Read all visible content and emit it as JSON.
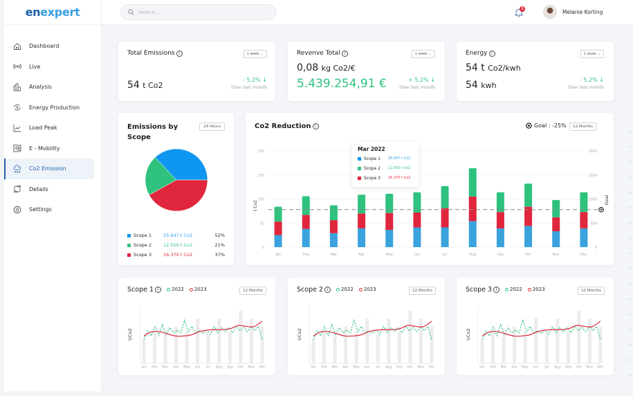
{
  "app": {
    "logo_part1": "en",
    "logo_part2": "expert"
  },
  "topbar": {
    "search_placeholder": "Search...",
    "notification_count": "2",
    "user_name": "Melanie Korting"
  },
  "sidebar": {
    "items": [
      {
        "label": "Dashboard",
        "icon": "home-icon"
      },
      {
        "label": "Live",
        "icon": "live-signal-icon"
      },
      {
        "label": "Analysis",
        "icon": "analysis-bars-icon"
      },
      {
        "label": "Energy Production",
        "icon": "energy-cycle-icon"
      },
      {
        "label": "Load Peak",
        "icon": "line-chart-icon"
      },
      {
        "label": "E - Mobility",
        "icon": "ev-charger-icon"
      },
      {
        "label": "Co2 Emission",
        "icon": "co2-cloud-icon",
        "active": true
      },
      {
        "label": "Details",
        "icon": "details-flow-icon"
      },
      {
        "label": "Settings",
        "icon": "gear-icon"
      }
    ]
  },
  "kpis": {
    "total_emissions": {
      "title": "Total Emissions",
      "period": "1 week",
      "value": "54",
      "unit": "t Co2",
      "delta": "- 5,2% ↓",
      "delta_label": "than last month"
    },
    "revenue_total": {
      "title": "Revenve Total",
      "period": "1 week",
      "value": "0,08",
      "unit": "kg Co2/€",
      "amount": "5.439.254,91 €",
      "delta": "+ 5,2% ↓",
      "delta_label": "than last month"
    },
    "energy": {
      "title": "Energy",
      "period": "1 week",
      "value": "54 t",
      "unit": "Co2/kwh",
      "value2": "54",
      "unit2": "kwh",
      "delta": "- 5,2% ↓",
      "delta_label": "than last month"
    }
  },
  "colors": {
    "scope1": "#2f9de4",
    "scope2": "#2ec27e",
    "scope3": "#e0263c",
    "accent": "#1f5fa6"
  },
  "chart_data": [
    {
      "type": "pie",
      "title": "Emissions by Scope",
      "period": "24 Hours",
      "labels": [
        "Scope 1",
        "Scope 2",
        "Scope 3"
      ],
      "amounts": [
        "25.647 t Co2",
        "12.550 t Co2",
        "16.370 t Co2"
      ],
      "percents": [
        "52%",
        "21%",
        "37%"
      ],
      "values": [
        37,
        21,
        42
      ],
      "colors": [
        "#0f96f0",
        "#2ec27e",
        "#e0263c"
      ]
    },
    {
      "type": "bar",
      "stacked": true,
      "title": "Co2 Reduction",
      "period": "12 Months",
      "goal_label": "Goal : -25%",
      "goal_axis_label": "Goal",
      "ylabel": "t Co2",
      "ylim": [
        0,
        200
      ],
      "yticks": [
        "0",
        "50",
        "100",
        "150",
        "200"
      ],
      "y2lim": [
        0,
        2000
      ],
      "y2ticks": [
        "0",
        "500",
        "1000",
        "1500",
        "2000"
      ],
      "goal_value": 78,
      "categories": [
        "Jan",
        "Feb",
        "Mar",
        "Apr",
        "May",
        "Jun",
        "Jul",
        "Aug",
        "Sep",
        "Oct",
        "Nov",
        "Dec"
      ],
      "series": [
        {
          "name": "Scope 1",
          "values": [
            25,
            38,
            29,
            39,
            36,
            41,
            41,
            54,
            39,
            44,
            33,
            39
          ]
        },
        {
          "name": "Scope 3",
          "values": [
            28,
            29,
            27,
            31,
            35,
            31,
            40,
            51,
            34,
            40,
            29,
            34
          ]
        },
        {
          "name": "Scope 2",
          "values": [
            31,
            39,
            31,
            39,
            40,
            42,
            46,
            59,
            41,
            48,
            36,
            41
          ]
        }
      ],
      "tooltip": {
        "title": "Mar 2022",
        "rows": [
          {
            "label": "Scope 1",
            "value": "25.647 t Co2"
          },
          {
            "label": "Scope 2",
            "value": "12.550 t Co2"
          },
          {
            "label": "Scope 3",
            "value": "16.370 t Co2"
          }
        ]
      }
    },
    {
      "type": "line",
      "title": "Scope 1",
      "period": "12 Months",
      "ylabel": "t/Co2",
      "categories": [
        "Jan",
        "Feb",
        "Mar",
        "Apr",
        "May",
        "Jun",
        "Jul",
        "Aug",
        "Sep",
        "Oct",
        "Nov",
        "Dec"
      ],
      "bars": [
        45,
        60,
        55,
        70,
        60,
        85,
        55,
        85,
        60,
        100,
        85,
        70
      ],
      "series": [
        {
          "name": "2022",
          "values": [
            45,
            62,
            52,
            70,
            52,
            74,
            54,
            68,
            58,
            63,
            58,
            82,
            60,
            70,
            58,
            62,
            57,
            63,
            55,
            70,
            58,
            68,
            60,
            68,
            58,
            70,
            62,
            68,
            60,
            70,
            62,
            70,
            45
          ]
        },
        {
          "name": "2023",
          "values": [
            52,
            60,
            60,
            56,
            52,
            52,
            54,
            60,
            63,
            64,
            64,
            66,
            72,
            70,
            70,
            80
          ]
        }
      ]
    },
    {
      "type": "line",
      "title": "Scope 2",
      "period": "12 Months",
      "ylabel": "t/Co2",
      "categories": [
        "Jan",
        "Feb",
        "Mar",
        "Apr",
        "May",
        "Jun",
        "Jul",
        "Aug",
        "Sep",
        "Oct",
        "Nov",
        "Dec"
      ],
      "bars": [
        45,
        60,
        55,
        70,
        60,
        85,
        55,
        85,
        60,
        100,
        85,
        70
      ],
      "series": [
        {
          "name": "2022",
          "values": [
            45,
            62,
            52,
            70,
            52,
            74,
            54,
            68,
            58,
            63,
            58,
            82,
            60,
            70,
            58,
            62,
            57,
            63,
            55,
            70,
            58,
            68,
            60,
            68,
            58,
            70,
            62,
            68,
            60,
            70,
            62,
            70,
            45
          ]
        },
        {
          "name": "2023",
          "values": [
            52,
            60,
            60,
            56,
            52,
            52,
            54,
            60,
            63,
            64,
            64,
            66,
            72,
            70,
            70,
            80
          ]
        }
      ]
    },
    {
      "type": "line",
      "title": "Scope 3",
      "period": "12 Months",
      "ylabel": "t/Co2",
      "categories": [
        "Jan",
        "Feb",
        "Mar",
        "Apr",
        "May",
        "Jun",
        "Jul",
        "Aug",
        "Sep",
        "Oct",
        "Nov",
        "Dec"
      ],
      "bars": [
        45,
        60,
        55,
        70,
        60,
        85,
        55,
        85,
        60,
        100,
        85,
        70
      ],
      "series": [
        {
          "name": "2022",
          "values": [
            45,
            62,
            52,
            70,
            52,
            74,
            54,
            68,
            58,
            63,
            58,
            82,
            60,
            70,
            58,
            62,
            57,
            63,
            55,
            70,
            58,
            68,
            60,
            68,
            58,
            70,
            62,
            68,
            60,
            70,
            62,
            70,
            45
          ]
        },
        {
          "name": "2023",
          "values": [
            52,
            60,
            60,
            56,
            52,
            52,
            54,
            60,
            63,
            64,
            64,
            66,
            72,
            70,
            70,
            80
          ]
        }
      ]
    }
  ]
}
